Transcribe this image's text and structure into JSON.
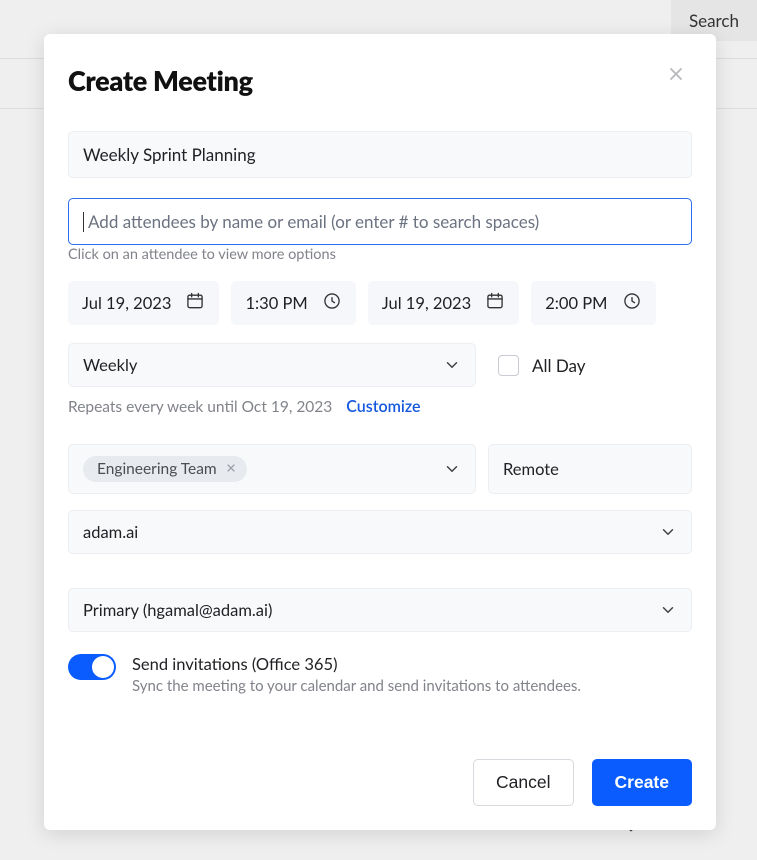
{
  "bg": {
    "search_label": "Search"
  },
  "modal": {
    "title": "Create Meeting",
    "title_value": "Weekly Sprint Planning",
    "attendees_placeholder": "Add attendees by name or email (or enter # to search spaces)",
    "attendees_hint": "Click on an attendee to view more options",
    "start_date": "Jul 19, 2023",
    "start_time": "1:30 PM",
    "end_date": "Jul 19, 2023",
    "end_time": "2:00 PM",
    "recurrence": "Weekly",
    "all_day_label": "All Day",
    "repeat_summary": "Repeats every week until Oct 19, 2023",
    "customize_label": "Customize",
    "team_chip": "Engineering Team",
    "location": "Remote",
    "workspace": "adam.ai",
    "calendar": "Primary (hgamal@adam.ai)",
    "toggle": {
      "title": "Send invitations (Office 365)",
      "subtitle": "Sync the meeting to your calendar and send invitations to attendees.",
      "on": true
    },
    "actions": {
      "cancel": "Cancel",
      "create": "Create"
    }
  }
}
